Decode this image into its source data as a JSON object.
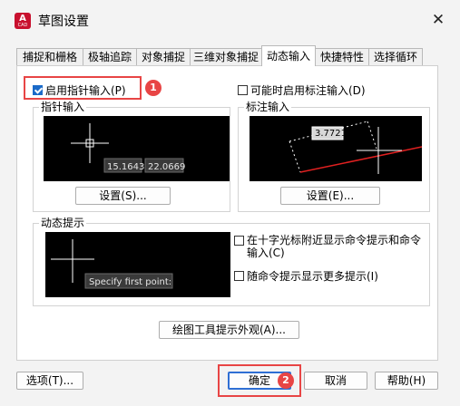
{
  "window": {
    "title": "草图设置",
    "app_icon_letter": "A",
    "app_icon_sub": "CAD",
    "close_glyph": "✕"
  },
  "tabs": [
    "捕捉和栅格",
    "极轴追踪",
    "对象捕捉",
    "三维对象捕捉",
    "动态输入",
    "快捷特性",
    "选择循环"
  ],
  "active_tab": "动态输入",
  "pointer_input": {
    "enable_label": "启用指针输入(P)",
    "checked": true,
    "group_label": "指针输入",
    "coord_x": "15.1643",
    "coord_y": "22.0669",
    "settings_button": "设置(S)..."
  },
  "dimension_input": {
    "enable_label": "可能时启用标注输入(D)",
    "checked": false,
    "group_label": "标注输入",
    "value": "3.7721",
    "settings_button": "设置(E)..."
  },
  "dynamic_prompts": {
    "group_label": "动态提示",
    "preview_text": "Specify first point:",
    "option1_label": "在十字光标附近显示命令提示和命令输入(C)",
    "option1_checked": false,
    "option2_label": "随命令提示显示更多提示(I)",
    "option2_checked": false
  },
  "drafting_tooltip_button": "绘图工具提示外观(A)...",
  "footer": {
    "options_button": "选项(T)...",
    "ok_button": "确定",
    "cancel_button": "取消",
    "help_button": "帮助(H)"
  },
  "annotations": {
    "badge1": "1",
    "badge2": "2",
    "color": "#e84545"
  }
}
